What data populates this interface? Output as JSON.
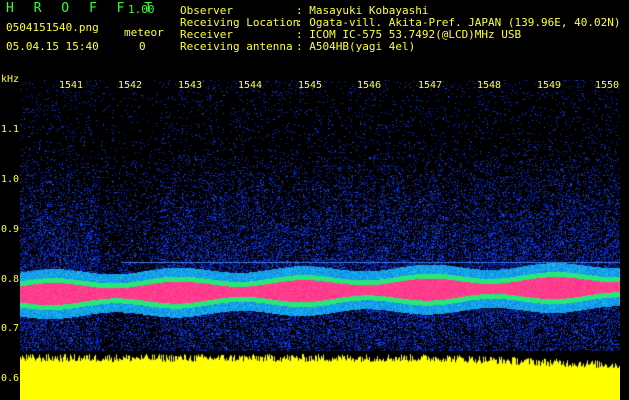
{
  "app": {
    "name": "H R O F F T",
    "version": "1.00"
  },
  "file": {
    "name": "0504151540.png",
    "datetime": "05.04.15 15:40"
  },
  "meteor": {
    "label": "meteor",
    "count": "0"
  },
  "info": [
    {
      "key": "Observer",
      "value": ": Masayuki Kobayashi"
    },
    {
      "key": "Receiving Location",
      "value": ": Ogata-vill. Akita-Pref. JAPAN (139.96E, 40.02N)"
    },
    {
      "key": "Receiver",
      "value": ": ICOM IC-575 53.7492(@LCD)MHz USB"
    },
    {
      "key": "Receiving antenna",
      "value": ": A504HB(yagi 4el)"
    }
  ],
  "axis": {
    "unit": "kHz",
    "y_ticks": [
      "1.1",
      "1.0",
      "0.9",
      "0.8",
      "0.7",
      "0.6"
    ],
    "time_ticks": [
      "1541",
      "1542",
      "1543",
      "1544",
      "1545",
      "1546",
      "1547",
      "1548",
      "1549",
      "1550"
    ]
  },
  "colors": {
    "background": "#000000",
    "text": "#ffff33",
    "title": "#33ff33",
    "noise": "#1e32c8",
    "signal": "#ff2a8a",
    "signal_edge": "#22e07a",
    "level_bar": "#ffff00"
  }
}
